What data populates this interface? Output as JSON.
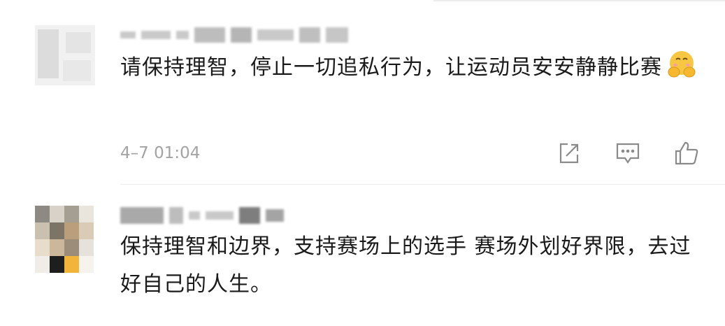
{
  "comments": [
    {
      "text": "请保持理智，停止一切追私行为，让运动员安安静静比赛",
      "emoji": "hugging-face-emoji",
      "timestamp": "4–7 01:04",
      "actions": [
        {
          "icon": "share-icon"
        },
        {
          "icon": "reply-icon"
        },
        {
          "icon": "like-icon"
        }
      ]
    },
    {
      "text": "保持理智和边界，支持赛场上的选手  赛场外划好界限，去过好自己的人生。"
    }
  ],
  "colors": {
    "text": "#1a1a1a",
    "meta": "#a3a3a3",
    "icon": "#8a8a8a",
    "emoji": "#f7c744",
    "divider": "#ececec"
  }
}
